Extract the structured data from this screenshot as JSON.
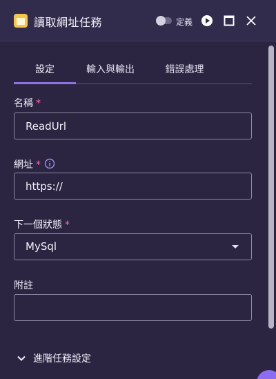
{
  "window": {
    "title": "讀取網址任務",
    "toggle_label": "定義",
    "toggle_on": false,
    "icons": [
      "task-icon",
      "play-icon",
      "maximize-icon",
      "close-icon"
    ]
  },
  "tabs": [
    {
      "label": "設定",
      "active": true
    },
    {
      "label": "輸入與輸出",
      "active": false
    },
    {
      "label": "錯誤處理",
      "active": false
    }
  ],
  "form": {
    "name": {
      "label": "名稱",
      "required_mark": "*",
      "value": "ReadUrl"
    },
    "url": {
      "label": "網址",
      "required_mark": "*",
      "value": "https://"
    },
    "next_state": {
      "label": "下一個狀態",
      "required_mark": "*",
      "value": "MySql"
    },
    "note": {
      "label": "附註",
      "value": ""
    }
  },
  "advanced": {
    "label": "進階任務設定"
  },
  "colors": {
    "background": "#2b2542",
    "header": "#322c4c",
    "accent": "#8d72e1",
    "required": "#ff6aa9",
    "task_icon": "#f3c64e"
  }
}
